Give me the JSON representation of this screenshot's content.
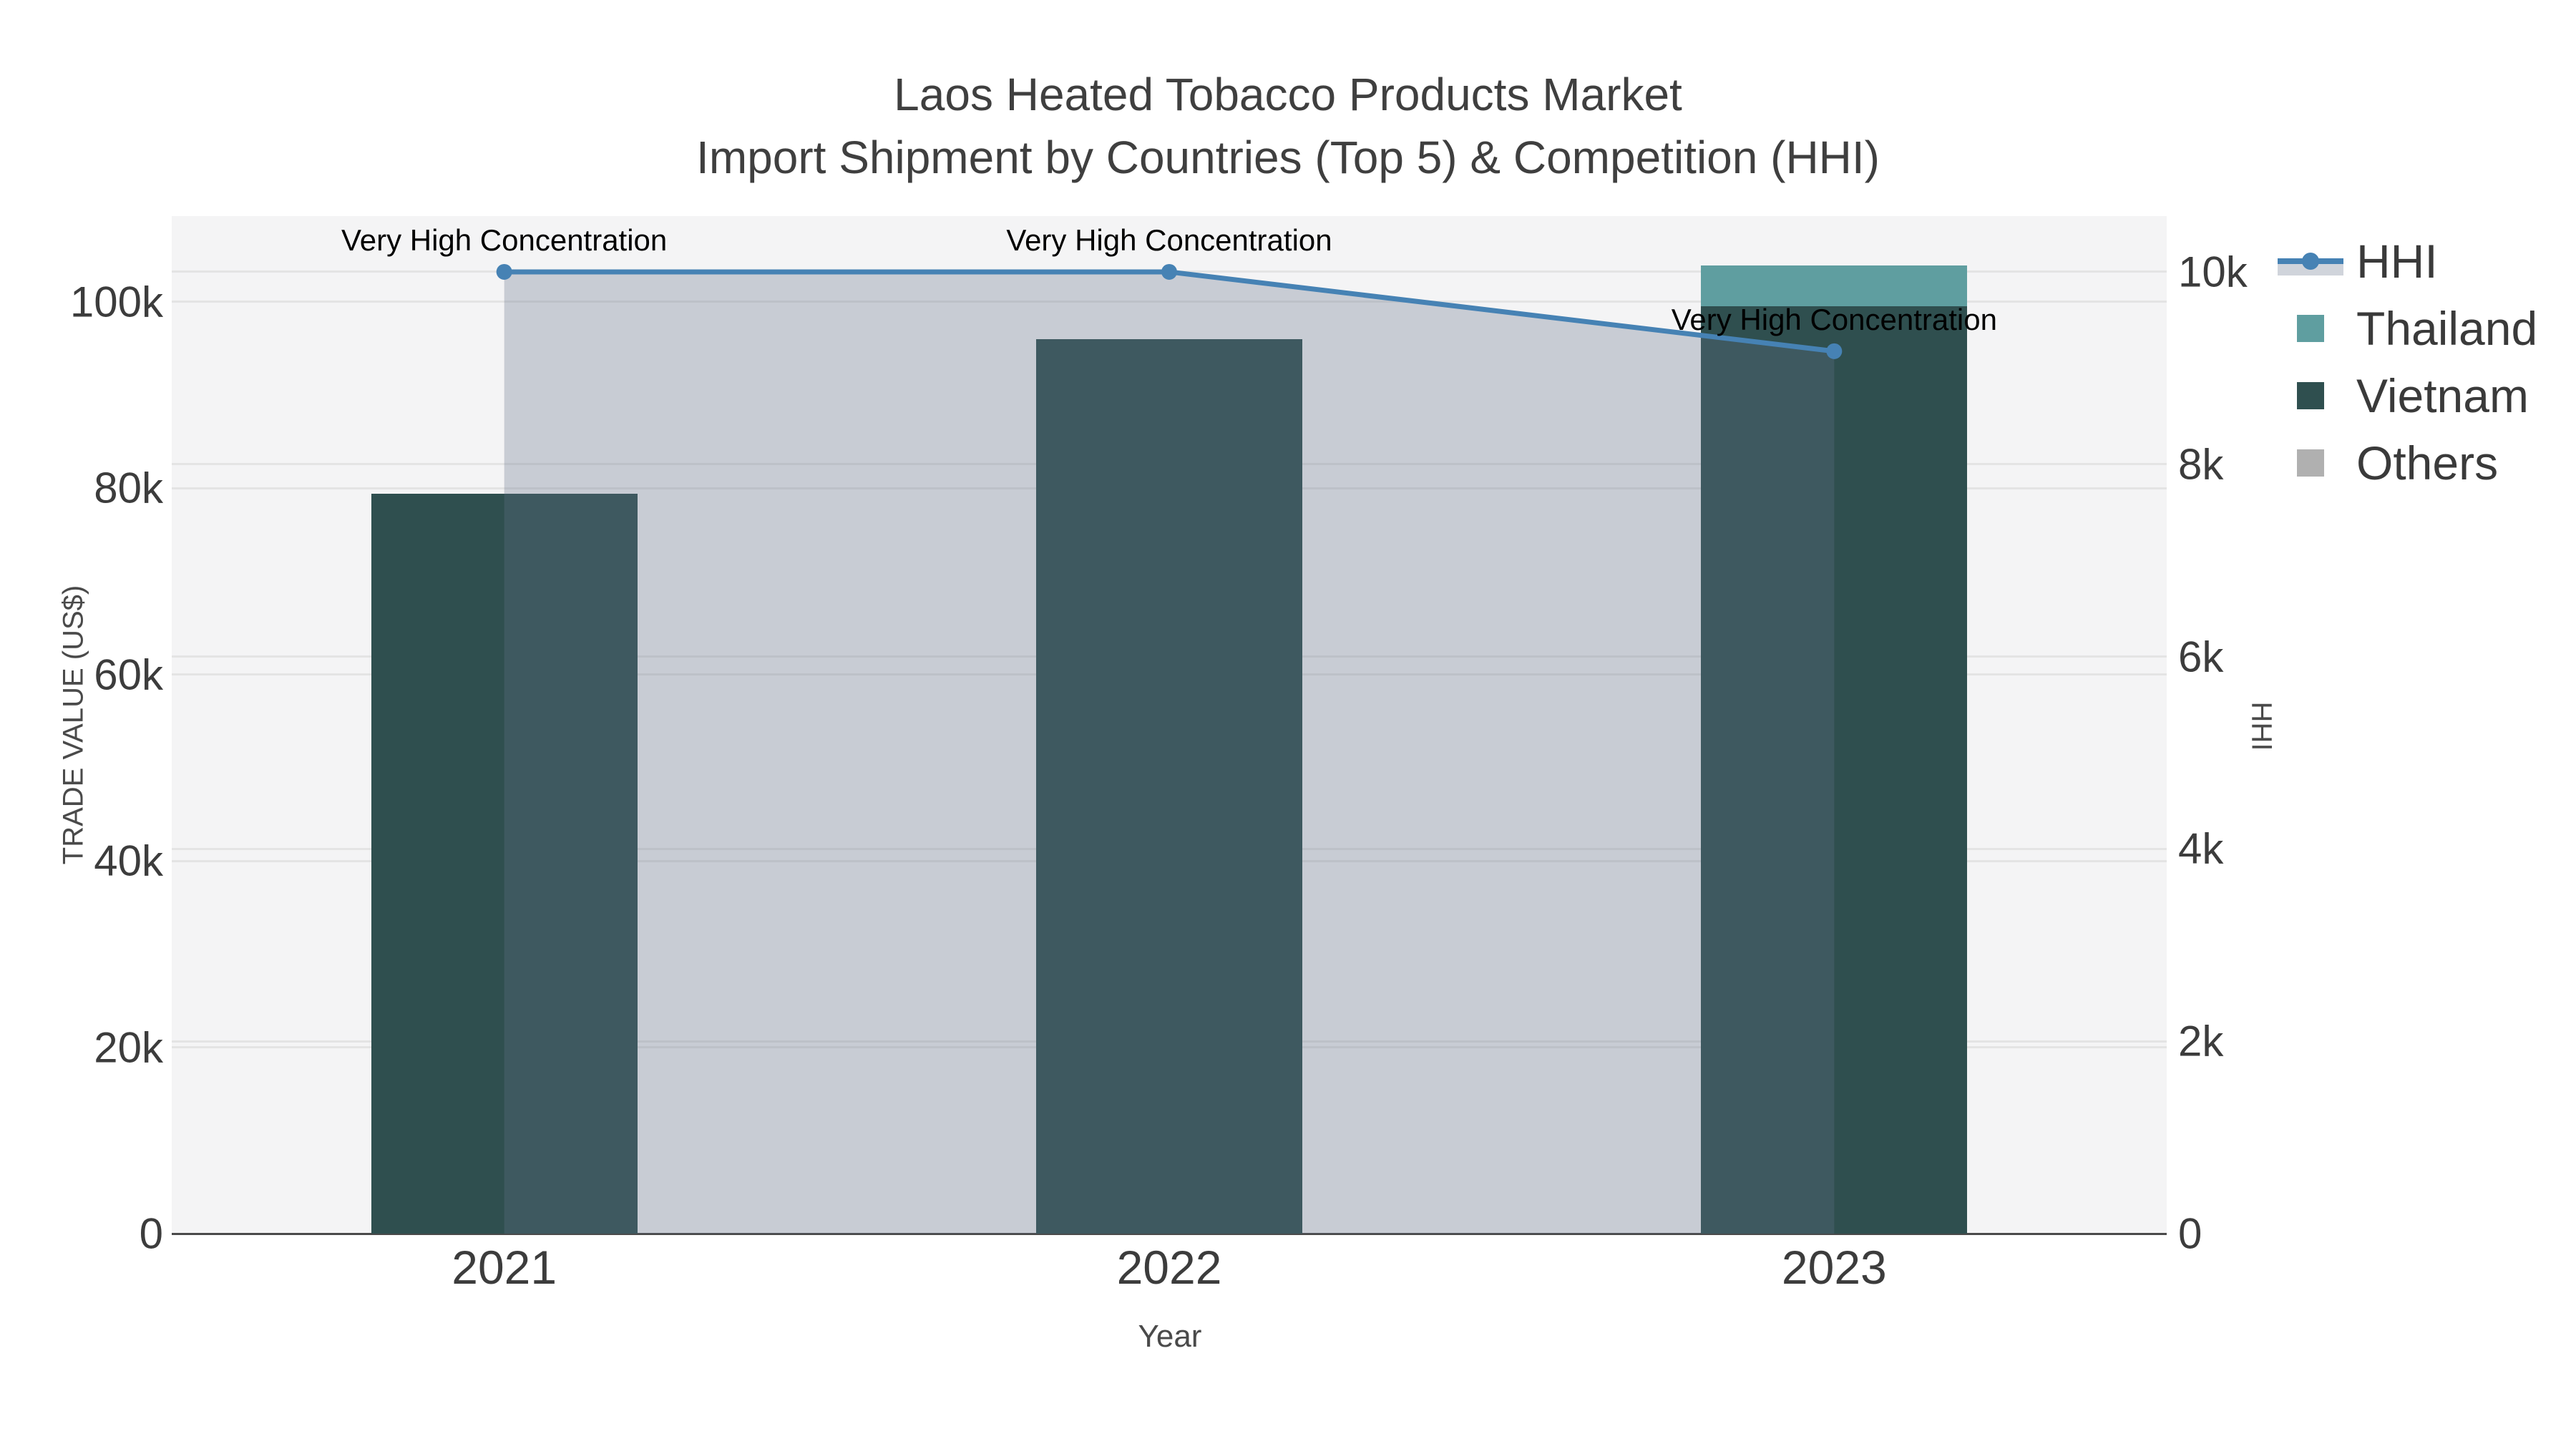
{
  "chart_data": {
    "type": "bar+line",
    "title": "Laos Heated Tobacco Products Market",
    "subtitle": "Import Shipment by Countries (Top 5) & Competition (HHI)",
    "categories": [
      "2021",
      "2022",
      "2023"
    ],
    "bar_series": [
      {
        "name": "Thailand",
        "color": "#5F9EA0",
        "values": [
          0,
          0,
          4400
        ]
      },
      {
        "name": "Vietnam",
        "color": "#2F4F4F",
        "values": [
          79400,
          96000,
          99500
        ]
      },
      {
        "name": "Others",
        "color": "#b0b0b0",
        "values": [
          0,
          0,
          0
        ]
      }
    ],
    "line_series": {
      "name": "HHI",
      "color": "#4682B4",
      "fill_color": "rgba(101,111,137,0.30)",
      "values": [
        10000,
        10000,
        9175
      ]
    },
    "annotations": [
      {
        "text": "Very High Concentration",
        "category": "2021"
      },
      {
        "text": "Very High Concentration",
        "category": "2022"
      },
      {
        "text": "Very High Concentration",
        "category": "2023"
      }
    ],
    "x_axis": {
      "title": "Year"
    },
    "y_left": {
      "title": "TRADE VALUE (US$)",
      "ticks": [
        "0",
        "20k",
        "40k",
        "60k",
        "80k",
        "100k"
      ],
      "tick_values": [
        0,
        20000,
        40000,
        60000,
        80000,
        100000
      ],
      "range": [
        0,
        109200
      ],
      "grid": true
    },
    "y_right": {
      "title": "HHI",
      "ticks": [
        "0",
        "2k",
        "4k",
        "6k",
        "8k",
        "10k"
      ],
      "tick_values": [
        0,
        2000,
        4000,
        6000,
        8000,
        10000
      ],
      "range": [
        0,
        10580
      ],
      "grid": true
    },
    "legend_position": "right",
    "plot_bg_color": "#f4f4f5"
  }
}
